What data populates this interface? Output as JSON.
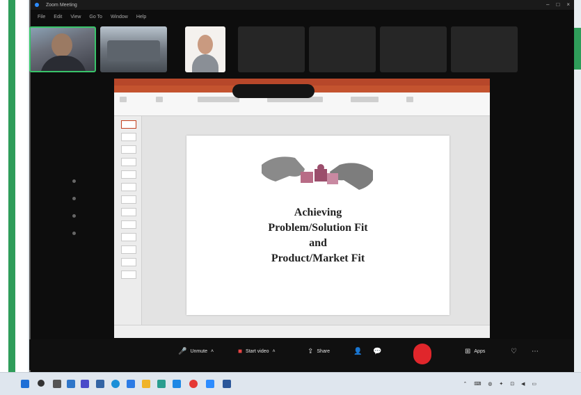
{
  "window": {
    "title": "Zoom Meeting",
    "menu": [
      "File",
      "Edit",
      "View",
      "Go To",
      "Window",
      "Help"
    ]
  },
  "participants": {
    "video": [
      {
        "label": ""
      },
      {
        "label": ""
      },
      {
        "label": ""
      }
    ],
    "names": [
      "",
      "",
      "",
      ""
    ]
  },
  "share_banner": "",
  "slide": {
    "title_lines": [
      "Achieving",
      "Problem/Solution Fit",
      "and",
      "Product/Market Fit"
    ],
    "author": ""
  },
  "toolbar": {
    "unmute_label": "Unmute",
    "video_label": "Start video",
    "share_label": "Share",
    "apps_label": "Apps"
  },
  "icons": {
    "mic": "mic-off-icon",
    "video": "video-off-icon",
    "share": "share-screen-icon",
    "end": "end-call-icon"
  },
  "colors": {
    "zoom_bg": "#0d0d0d",
    "active_speaker": "#39c46a",
    "ppt_accent": "#b7472a",
    "end_call": "#e0262b"
  }
}
